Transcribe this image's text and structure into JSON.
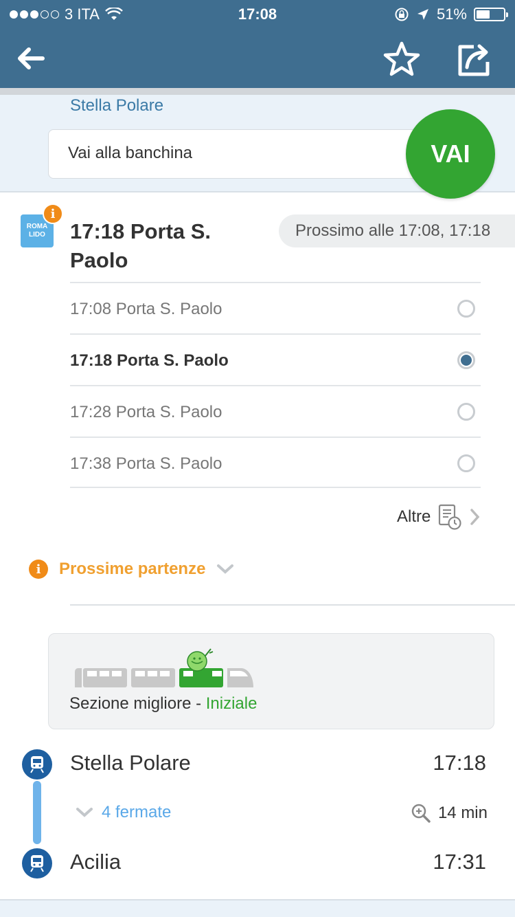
{
  "status_bar": {
    "carrier": "3 ITA",
    "time": "17:08",
    "battery": "51%",
    "battery_level": 0.51
  },
  "header": {
    "back_icon": "arrow-left-icon",
    "favorite_icon": "star-outline-icon",
    "share_icon": "share-icon"
  },
  "origin": {
    "station": "Stella Polare",
    "instruction_placeholder": "Vai alla banchina",
    "go_button": "VAI"
  },
  "departure": {
    "line_badge": [
      "ROMA",
      "LIDO"
    ],
    "info_badge": "i",
    "title": "17:18 Porta S. Paolo",
    "next_label": "Prossimo alle 17:08, 17:18",
    "options": [
      {
        "label": "17:08 Porta S. Paolo",
        "selected": false
      },
      {
        "label": "17:18 Porta S. Paolo",
        "selected": true
      },
      {
        "label": "17:28 Porta S. Paolo",
        "selected": false
      },
      {
        "label": "17:38 Porta S. Paolo",
        "selected": false
      }
    ],
    "more_label": "Altre"
  },
  "next_departures": {
    "label": "Prossime partenze",
    "icon": "info-icon"
  },
  "best_section": {
    "label": "Sezione migliore - ",
    "value": "Iniziale",
    "accent_color": "#33a532"
  },
  "itinerary": {
    "from": {
      "name": "Stella Polare",
      "time": "17:18"
    },
    "stops_label": "4 fermate",
    "duration": "14 min",
    "to": {
      "name": "Acilia",
      "time": "17:31"
    }
  },
  "colors": {
    "header": "#3f6e90",
    "go": "#33a532",
    "warning": "#f08b18",
    "line": "#6fb3ea",
    "stop": "#1e5fa0"
  }
}
